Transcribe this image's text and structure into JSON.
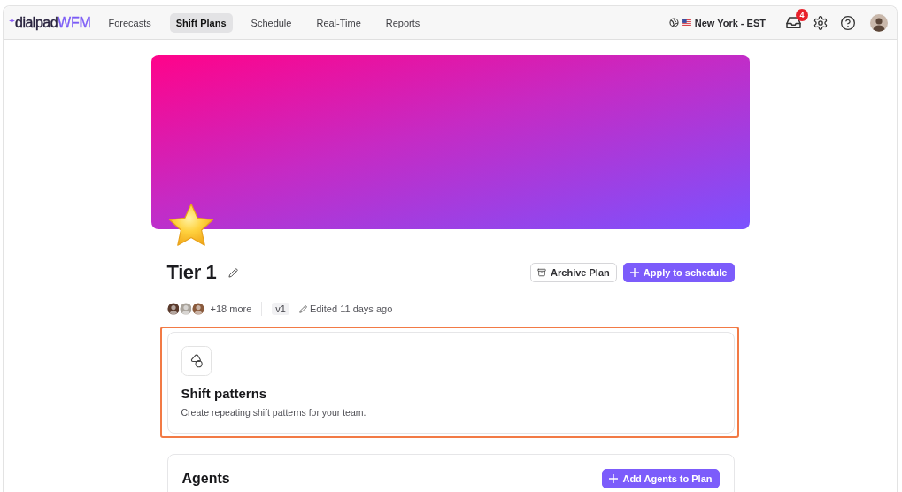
{
  "nav": {
    "logo": {
      "name": "dialpad",
      "product": "WFM"
    },
    "tabs": [
      {
        "label": "Forecasts",
        "selected": false
      },
      {
        "label": "Shift Plans",
        "selected": true
      },
      {
        "label": "Schedule",
        "selected": false
      },
      {
        "label": "Real-Time",
        "selected": false
      },
      {
        "label": "Reports",
        "selected": false
      }
    ],
    "timezone": "New York - EST",
    "notifications": "4"
  },
  "plan": {
    "title": "Tier 1",
    "actions": [
      {
        "label": "Archive Plan",
        "kind": "secondary"
      },
      {
        "label": "Apply to schedule",
        "kind": "primary"
      }
    ],
    "more_members": "+18 more",
    "version": "v1",
    "edited": "Edited 11 days ago"
  },
  "sections": [
    {
      "kind": "feature",
      "title": "Shift patterns",
      "description": "Create repeating shift patterns for your team.",
      "highlighted": true
    },
    {
      "kind": "list",
      "title": "Agents",
      "action": "Add Agents to Plan",
      "highlighted": false
    }
  ]
}
